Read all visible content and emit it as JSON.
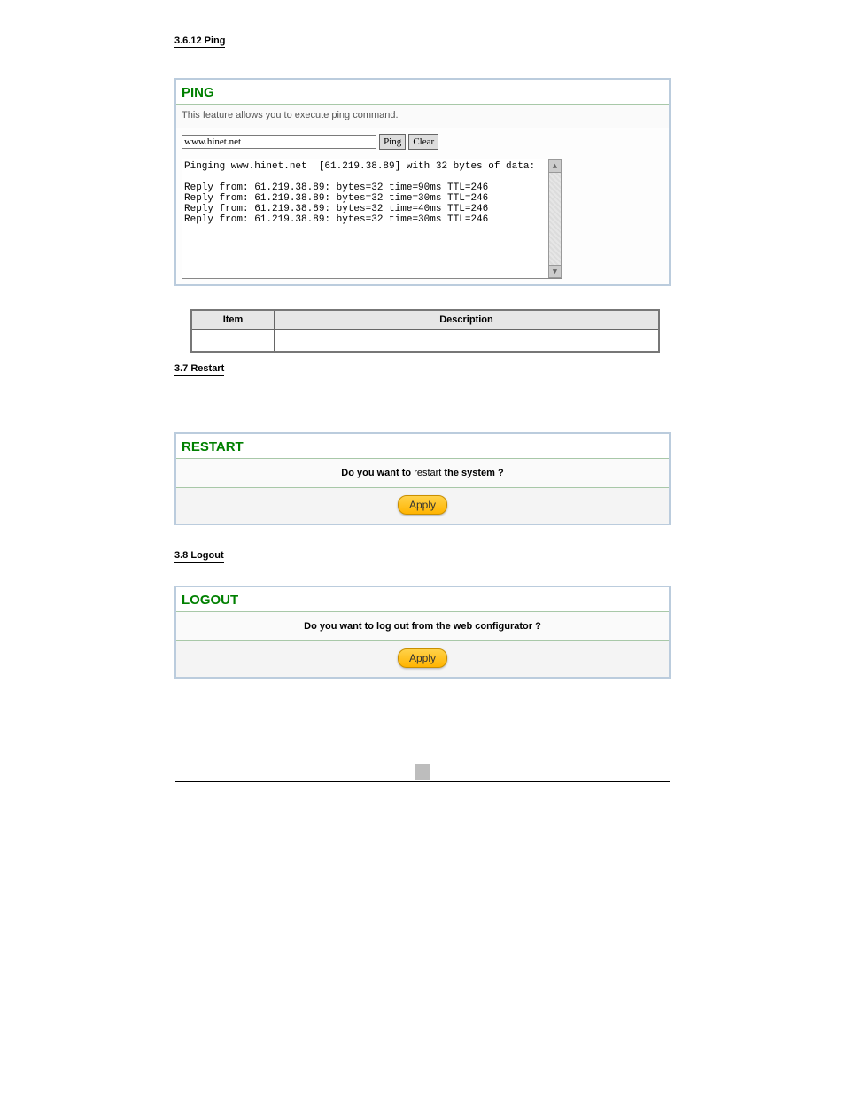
{
  "section_ping": {
    "label": "3.6.12 Ping",
    "note_after_table": ""
  },
  "ping_panel": {
    "title": "PING",
    "subtitle": "This feature allows you to execute ping command.",
    "input_value": "www.hinet.net",
    "btn_ping": "Ping",
    "btn_clear": "Clear",
    "terminal_text": "Pinging www.hinet.net  [61.219.38.89] with 32 bytes of data:\n\nReply from: 61.219.38.89: bytes=32 time=90ms TTL=246\nReply from: 61.219.38.89: bytes=32 time=30ms TTL=246\nReply from: 61.219.38.89: bytes=32 time=40ms TTL=246\nReply from: 61.219.38.89: bytes=32 time=30ms TTL=246"
  },
  "ping_table": {
    "headers": [
      "Item",
      "Description"
    ],
    "rows": [
      [
        "",
        ""
      ]
    ]
  },
  "section_restart": {
    "label": "3.7 Restart"
  },
  "restart_panel": {
    "title": "RESTART",
    "msg_bold1": "Do you want to ",
    "msg_norm": "restart",
    "msg_bold2": " the system ?",
    "btn": "Apply"
  },
  "section_logout": {
    "label": "3.8 Logout"
  },
  "logout_panel": {
    "title": "LOGOUT",
    "msg": "Do you want to log out from the web configurator ?",
    "btn": "Apply"
  },
  "page_number": ""
}
